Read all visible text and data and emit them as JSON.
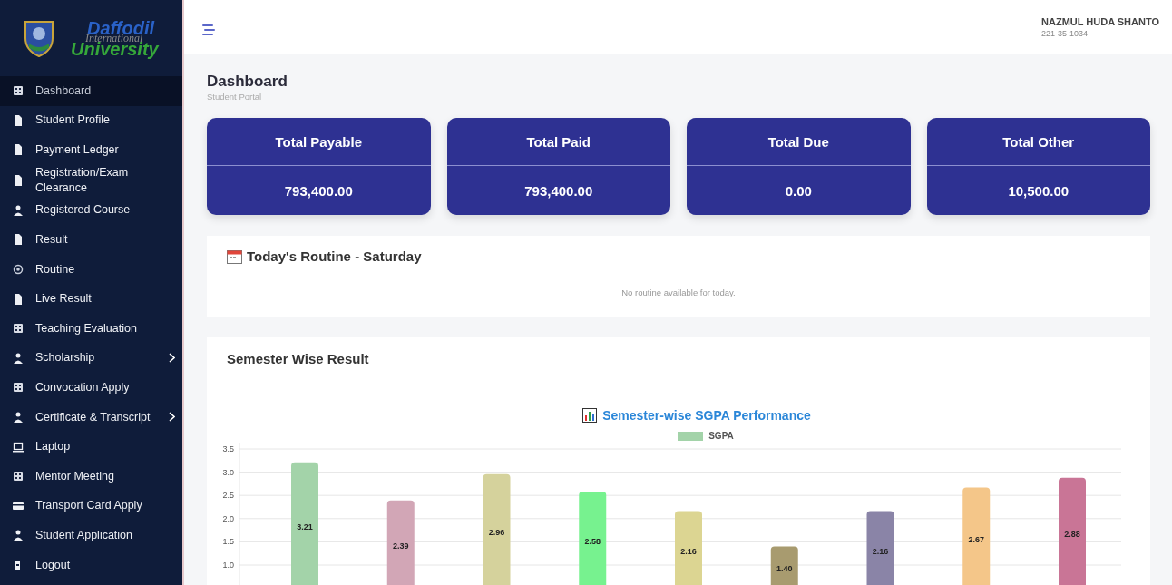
{
  "logo": {
    "line_1": "Daffodil",
    "line_2": "International",
    "line_3": "University"
  },
  "sidebar": {
    "items": [
      {
        "label": "Dashboard",
        "selected": true,
        "submenu": false
      },
      {
        "label": "Student Profile",
        "selected": false,
        "submenu": false
      },
      {
        "label": "Payment Ledger",
        "selected": false,
        "submenu": false
      },
      {
        "label": "Registration/Exam Clearance",
        "selected": false,
        "submenu": false
      },
      {
        "label": "Registered Course",
        "selected": false,
        "submenu": false
      },
      {
        "label": "Result",
        "selected": false,
        "submenu": false
      },
      {
        "label": "Routine",
        "selected": false,
        "submenu": false
      },
      {
        "label": "Live Result",
        "selected": false,
        "submenu": false
      },
      {
        "label": "Teaching Evaluation",
        "selected": false,
        "submenu": false
      },
      {
        "label": "Scholarship",
        "selected": false,
        "submenu": true
      },
      {
        "label": "Convocation Apply",
        "selected": false,
        "submenu": false
      },
      {
        "label": "Certificate & Transcript",
        "selected": false,
        "submenu": true
      },
      {
        "label": "Laptop",
        "selected": false,
        "submenu": false
      },
      {
        "label": "Mentor Meeting",
        "selected": false,
        "submenu": false
      },
      {
        "label": "Transport Card Apply",
        "selected": false,
        "submenu": false
      },
      {
        "label": "Student Application",
        "selected": false,
        "submenu": false
      },
      {
        "label": "Logout",
        "selected": false,
        "submenu": false
      }
    ]
  },
  "user": {
    "name": "NAZMUL HUDA SHANTO",
    "id": "221-35-1034"
  },
  "page": {
    "title": "Dashboard",
    "subtitle": "Student Portal"
  },
  "summary_cards": [
    {
      "label": "Total Payable",
      "value": "793,400.00"
    },
    {
      "label": "Total Paid",
      "value": "793,400.00"
    },
    {
      "label": "Total Due",
      "value": "0.00"
    },
    {
      "label": "Total Other",
      "value": "10,500.00"
    }
  ],
  "routine": {
    "title": "Today's Routine - Saturday",
    "message": "No routine available for today."
  },
  "result": {
    "title": "Semester Wise Result",
    "chart_data": {
      "type": "bar",
      "title": "Semester-wise SGPA Performance",
      "ylim": [
        0,
        3.5
      ],
      "grid": true,
      "yticks": [
        {
          "value": 1,
          "label": "1.0"
        },
        {
          "value": 1.5,
          "label": "1.5"
        },
        {
          "value": 2,
          "label": "2.0"
        },
        {
          "value": 2.5,
          "label": "2.5"
        },
        {
          "value": 3,
          "label": "3.0"
        },
        {
          "value": 3.5,
          "label": "3.5"
        }
      ],
      "value_labels": [
        "3.21",
        "2.39",
        "2.96",
        "2.58",
        "2.16",
        "1.40",
        "2.16",
        "2.67",
        "2.88"
      ],
      "series": [
        {
          "name": "SGPA",
          "color": "#a3d3a9",
          "values": [
            3.21,
            2.39,
            2.96,
            2.58,
            2.16,
            1.4,
            2.16,
            2.67,
            2.88
          ],
          "colors": [
            "#a3d3a9",
            "#d2a6b6",
            "#d5d29c",
            "#77f28f",
            "#dcd592",
            "#a89b6f",
            "#8a84a7",
            "#f4c689",
            "#c97596"
          ]
        }
      ]
    }
  }
}
